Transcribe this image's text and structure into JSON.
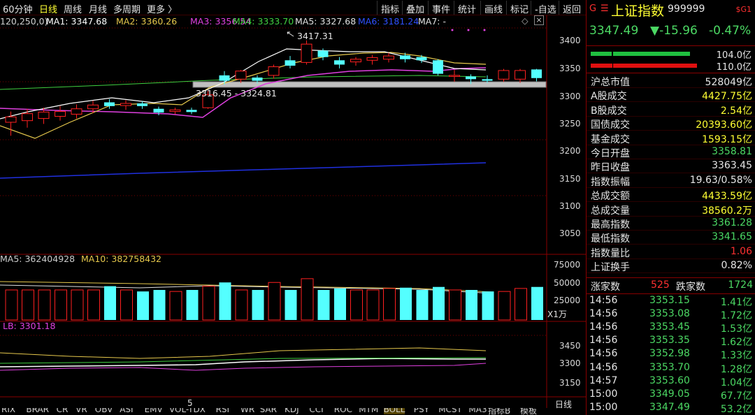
{
  "toolbar": {
    "periods": [
      "60分钟",
      "日线",
      "周线",
      "月线",
      "多周期",
      "更多 〉"
    ],
    "active_period": "日线",
    "buttons": [
      "指标",
      "叠加",
      "事件",
      "统计",
      "画线",
      "标记",
      "-自选",
      "返回"
    ],
    "close_icon": "close-icon"
  },
  "ma_legend": {
    "params": "120,250,0)",
    "ma1": "MA1: 3347.68",
    "ma2": "MA2: 3360.26",
    "ma3": "MA3: 3356.54",
    "ma4": "MA4: 3333.70",
    "ma5": "MA5: 3327.68",
    "ma6": "MA6: 3181.24",
    "ma7": "MA7: -",
    "colors": {
      "ma1": "#ffffff",
      "ma2": "#e6c84c",
      "ma3": "#e040e0",
      "ma4": "#40d040",
      "ma5": "#e0e0e0",
      "ma6": "#2020d0"
    }
  },
  "annotations": {
    "high": "3417.31",
    "low_range": "3316.45 - 3324.81"
  },
  "price_axis": {
    "ticks": [
      "3400",
      "3350",
      "3300",
      "3250",
      "3200",
      "3150",
      "3100",
      "3050"
    ]
  },
  "volume": {
    "ma5": "MA5: 362404928",
    "ma10": "MA10: 382758432",
    "axis_ticks": [
      "75000",
      "50000",
      "25000"
    ],
    "unit": "X1万"
  },
  "lb": {
    "label": "LB: 3301.18",
    "axis_ticks": [
      "3450",
      "3300",
      "3150"
    ]
  },
  "x_axis": {
    "mark": "5",
    "period_label": "日线"
  },
  "bottom_tabs": [
    "RIX",
    "BRAR",
    "CR",
    "VR",
    "OBV",
    "ASI",
    "EMV",
    "VOL-TDX",
    "RSI",
    "WR",
    "SAR",
    "KDJ",
    "CCI",
    "ROC",
    "MTM",
    "BOLL",
    "PSY",
    "MCST",
    "MA3"
  ],
  "bottom_right": [
    "指标B",
    "模板"
  ],
  "chart_data": {
    "type": "candlestick",
    "ylim": [
      3020,
      3440
    ],
    "candles": [
      {
        "o": 3265,
        "c": 3275,
        "h": 3285,
        "l": 3240,
        "up": true
      },
      {
        "o": 3268,
        "c": 3281,
        "h": 3290,
        "l": 3255,
        "up": true
      },
      {
        "o": 3272,
        "c": 3284,
        "h": 3292,
        "l": 3262,
        "up": true
      },
      {
        "o": 3276,
        "c": 3285,
        "h": 3295,
        "l": 3268,
        "up": true
      },
      {
        "o": 3280,
        "c": 3290,
        "h": 3298,
        "l": 3272,
        "up": true
      },
      {
        "o": 3290,
        "c": 3297,
        "h": 3305,
        "l": 3282,
        "up": true
      },
      {
        "o": 3302,
        "c": 3295,
        "h": 3308,
        "l": 3290,
        "up": false
      },
      {
        "o": 3296,
        "c": 3300,
        "h": 3306,
        "l": 3288,
        "up": true
      },
      {
        "o": 3300,
        "c": 3295,
        "h": 3304,
        "l": 3290,
        "up": false
      },
      {
        "o": 3290,
        "c": 3283,
        "h": 3294,
        "l": 3278,
        "up": false
      },
      {
        "o": 3288,
        "c": 3285,
        "h": 3292,
        "l": 3280,
        "up": true
      },
      {
        "o": 3288,
        "c": 3284,
        "h": 3292,
        "l": 3280,
        "up": false
      },
      {
        "o": 3292,
        "c": 3316,
        "h": 3324,
        "l": 3290,
        "up": true
      },
      {
        "o": 3352,
        "c": 3342,
        "h": 3360,
        "l": 3335,
        "up": false
      },
      {
        "o": 3345,
        "c": 3360,
        "h": 3362,
        "l": 3338,
        "up": true
      },
      {
        "o": 3348,
        "c": 3342,
        "h": 3352,
        "l": 3337,
        "up": false
      },
      {
        "o": 3352,
        "c": 3368,
        "h": 3372,
        "l": 3346,
        "up": true
      },
      {
        "o": 3380,
        "c": 3370,
        "h": 3388,
        "l": 3365,
        "up": false
      },
      {
        "o": 3376,
        "c": 3410,
        "h": 3417,
        "l": 3372,
        "up": true
      },
      {
        "o": 3398,
        "c": 3386,
        "h": 3402,
        "l": 3380,
        "up": false
      },
      {
        "o": 3380,
        "c": 3372,
        "h": 3386,
        "l": 3365,
        "up": false
      },
      {
        "o": 3377,
        "c": 3382,
        "h": 3386,
        "l": 3370,
        "up": true
      },
      {
        "o": 3380,
        "c": 3385,
        "h": 3390,
        "l": 3372,
        "up": true
      },
      {
        "o": 3382,
        "c": 3388,
        "h": 3394,
        "l": 3376,
        "up": true
      },
      {
        "o": 3389,
        "c": 3382,
        "h": 3394,
        "l": 3376,
        "up": false
      },
      {
        "o": 3386,
        "c": 3380,
        "h": 3390,
        "l": 3375,
        "up": false
      },
      {
        "o": 3380,
        "c": 3355,
        "h": 3382,
        "l": 3352,
        "up": false
      },
      {
        "o": 3352,
        "c": 3350,
        "h": 3362,
        "l": 3340,
        "up": true
      },
      {
        "o": 3350,
        "c": 3345,
        "h": 3354,
        "l": 3336,
        "up": false
      },
      {
        "o": 3345,
        "c": 3342,
        "h": 3352,
        "l": 3338,
        "up": false
      },
      {
        "o": 3345,
        "c": 3361,
        "h": 3364,
        "l": 3340,
        "up": true
      },
      {
        "o": 3345,
        "c": 3361,
        "h": 3364,
        "l": 3338,
        "up": true
      },
      {
        "o": 3363,
        "c": 3347,
        "h": 3364,
        "l": 3341,
        "up": false
      }
    ],
    "volumes": [
      40000,
      40000,
      40000,
      40000,
      40000,
      40000,
      45000,
      40000,
      38000,
      40000,
      38000,
      40000,
      45000,
      50000,
      40000,
      40000,
      50000,
      40000,
      55000,
      40000,
      42000,
      40000,
      40000,
      42000,
      43000,
      40000,
      44000,
      40000,
      40000,
      38000,
      38000,
      42000,
      44000
    ]
  },
  "quote": {
    "icons": [
      "G",
      "☰"
    ],
    "name": "上证指数",
    "code": "999999",
    "tag": "$G1",
    "price": "3347.49",
    "change": "▼-15.96",
    "pct": "-0.47%",
    "bar1": "104.0亿",
    "bar2": "110.0亿",
    "rows": [
      {
        "k": "沪总市值",
        "v": "528049亿",
        "c": "w"
      },
      {
        "k": "A股成交",
        "v": "4427.75亿",
        "c": "y"
      },
      {
        "k": "B股成交",
        "v": "2.54亿",
        "c": "y"
      },
      {
        "k": "国债成交",
        "v": "20393.60亿",
        "c": "y"
      },
      {
        "k": "基金成交",
        "v": "1593.15亿",
        "c": "y"
      },
      {
        "k": "今日开盘",
        "v": "3358.81",
        "c": "g"
      },
      {
        "k": "昨日收盘",
        "v": "3363.45",
        "c": "w"
      },
      {
        "k": "指数振幅",
        "v": "19.63/0.58%",
        "c": "w"
      },
      {
        "k": "总成交额",
        "v": "4433.59亿",
        "c": "y"
      },
      {
        "k": "总成交量",
        "v": "38560.2万",
        "c": "y"
      },
      {
        "k": "最高指数",
        "v": "3361.28",
        "c": "g"
      },
      {
        "k": "最低指数",
        "v": "3341.65",
        "c": "g"
      },
      {
        "k": "指数量比",
        "v": "1.06",
        "c": "r"
      },
      {
        "k": "上证换手",
        "v": "0.82%",
        "c": "w"
      }
    ],
    "adv_label": "涨家数",
    "adv": "525",
    "dec_label": "跌家数",
    "dec": "1724",
    "ticks": [
      {
        "t": "14:56",
        "p": "3353.15",
        "v": "1.41亿"
      },
      {
        "t": "14:56",
        "p": "3353.08",
        "v": "1.72亿"
      },
      {
        "t": "14:56",
        "p": "3353.45",
        "v": "1.53亿"
      },
      {
        "t": "14:56",
        "p": "3353.35",
        "v": "1.62亿"
      },
      {
        "t": "14:56",
        "p": "3352.98",
        "v": "1.33亿"
      },
      {
        "t": "14:56",
        "p": "3353.70",
        "v": "1.28亿"
      },
      {
        "t": "14:57",
        "p": "3353.60",
        "v": "1.04亿"
      },
      {
        "t": "15:00",
        "p": "3349.05",
        "v": "67.7亿"
      },
      {
        "t": "15:00",
        "p": "3347.49",
        "v": "53.2亿"
      }
    ]
  }
}
